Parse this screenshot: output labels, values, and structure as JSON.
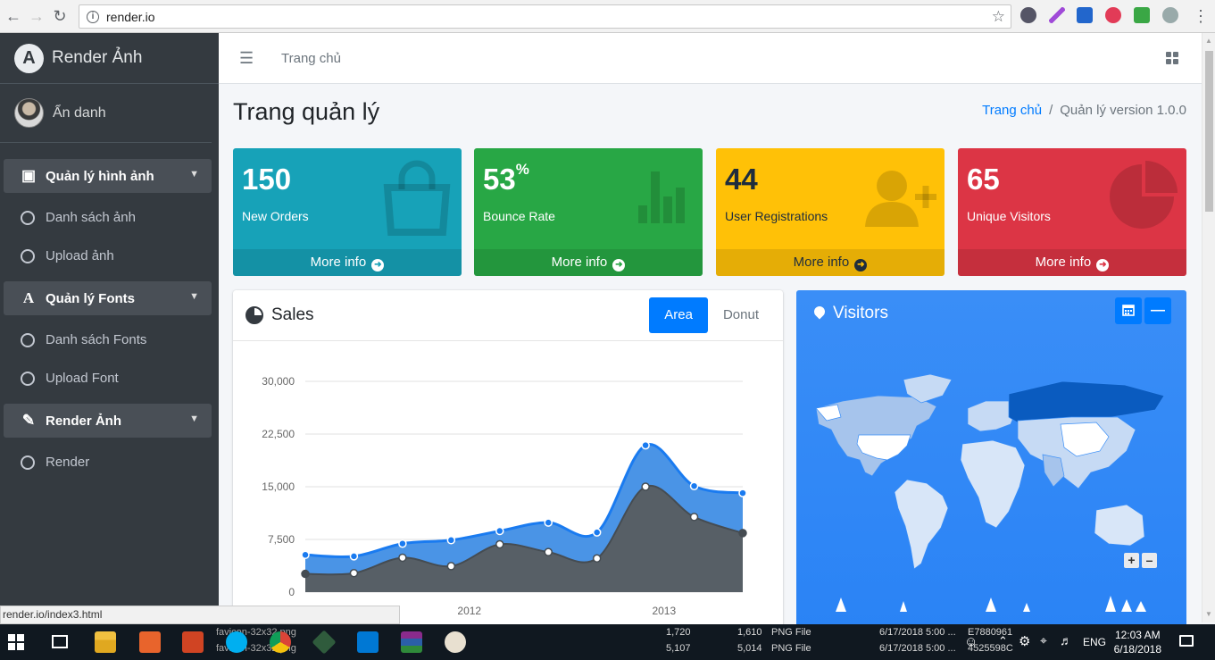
{
  "browser": {
    "url": "render.io",
    "status_url": "render.io/index3.html"
  },
  "sidebar": {
    "brand": "Render Ảnh",
    "user": "Ẩn danh",
    "groups": [
      {
        "label": "Quản lý hình ảnh",
        "icon": "image-icon",
        "items": [
          "Danh sách ảnh",
          "Upload ảnh"
        ]
      },
      {
        "label": "Quản lý Fonts",
        "icon": "font-icon",
        "items": [
          "Danh sách Fonts",
          "Upload Font"
        ]
      },
      {
        "label": "Render Ảnh",
        "icon": "edit-icon",
        "items": [
          "Render"
        ]
      }
    ]
  },
  "topbar": {
    "home": "Trang chủ"
  },
  "header": {
    "title": "Trang quản lý",
    "breadcrumb_home": "Trang chủ",
    "breadcrumb_sep": "/",
    "breadcrumb_current": "Quản lý version 1.0.0"
  },
  "stats": [
    {
      "value": "150",
      "suffix": "",
      "label": "New Orders",
      "more": "More info",
      "color": "#17a2b8",
      "icon": "shopping-bag-icon"
    },
    {
      "value": "53",
      "suffix": "%",
      "label": "Bounce Rate",
      "more": "More info",
      "color": "#28a745",
      "icon": "bar-chart-icon"
    },
    {
      "value": "44",
      "suffix": "",
      "label": "User Registrations",
      "more": "More info",
      "color": "#ffc107",
      "icon": "user-plus-icon"
    },
    {
      "value": "65",
      "suffix": "",
      "label": "Unique Visitors",
      "more": "More info",
      "color": "#dc3545",
      "icon": "pie-chart-icon"
    }
  ],
  "sales": {
    "title": "Sales",
    "tabs": [
      "Area",
      "Donut"
    ],
    "active_tab": "Area"
  },
  "visitors": {
    "title": "Visitors"
  },
  "chart_data": {
    "type": "area",
    "title": "",
    "xlabel": "",
    "ylabel": "",
    "ylim": [
      0,
      30000
    ],
    "yticks": [
      "0",
      "7,500",
      "15,000",
      "22,500",
      "30,000"
    ],
    "xticks": [
      "2012",
      "2013"
    ],
    "series": [
      {
        "name": "",
        "color": "#3c8dbc",
        "values": [
          5300,
          5100,
          6900,
          7400,
          8700,
          9900,
          8500,
          20900,
          15100,
          14100
        ]
      },
      {
        "name": "",
        "color": "#575f66",
        "values": [
          2600,
          2700,
          4900,
          3700,
          6800,
          5700,
          4800,
          15000,
          10700,
          8400
        ]
      }
    ]
  },
  "taskbar": {
    "lang": "ENG",
    "time": "12:03 AM",
    "date": "6/18/2018",
    "file_rows": [
      {
        "name": "favicon-32x32.png",
        "size1": "1,720",
        "size2": "1,610",
        "type": "PNG File",
        "date": "6/17/2018 5:00 ...",
        "hash": "E7880961"
      },
      {
        "name": "favicon-32x32.png",
        "size1": "5,107",
        "size2": "5,014",
        "type": "PNG File",
        "date": "6/17/2018 5:00 ...",
        "hash": "4525598C"
      }
    ]
  }
}
